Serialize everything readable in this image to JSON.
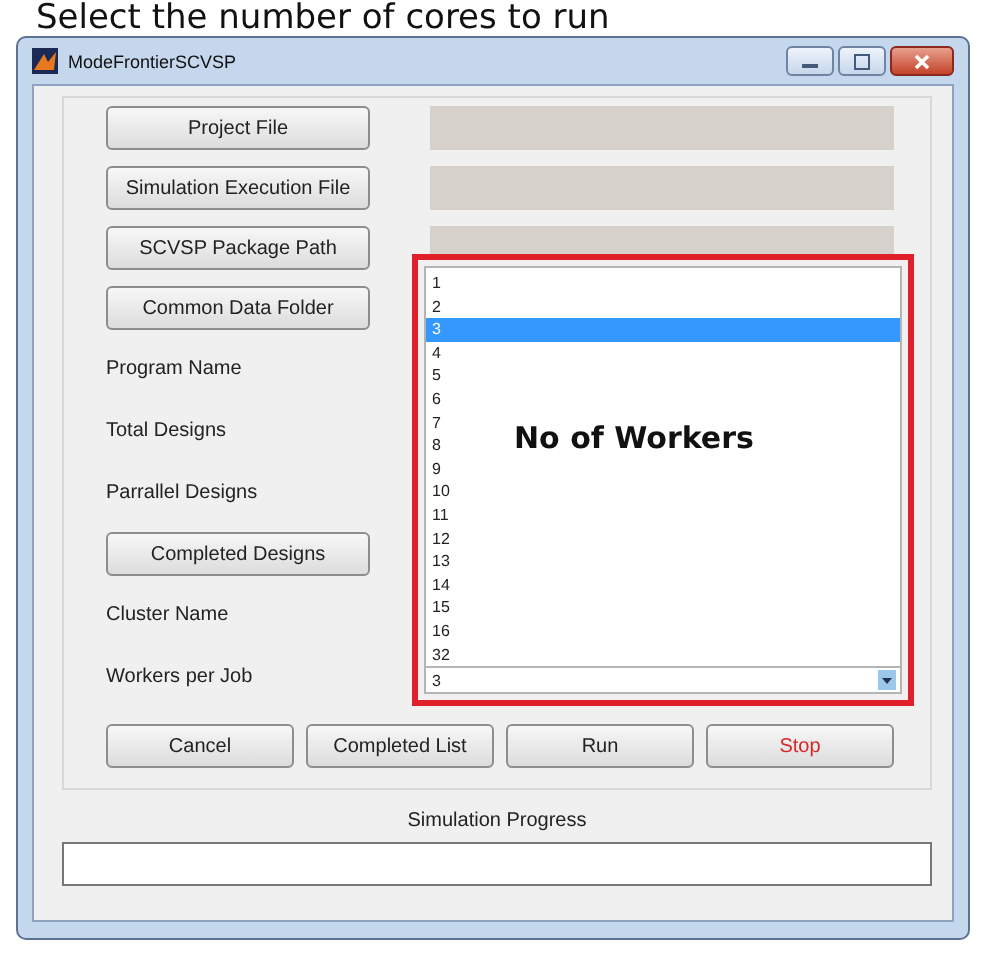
{
  "caption": "Select the number of cores to run",
  "window": {
    "title": "ModeFrontierSCVSP"
  },
  "rows": [
    {
      "kind": "button",
      "label": "Project File",
      "field": true
    },
    {
      "kind": "button",
      "label": "Simulation Execution File",
      "field": true
    },
    {
      "kind": "button",
      "label": "SCVSP Package Path",
      "field": true
    },
    {
      "kind": "button",
      "label": "Common Data Folder"
    },
    {
      "kind": "label",
      "label": "Program Name"
    },
    {
      "kind": "label",
      "label": "Total Designs"
    },
    {
      "kind": "label",
      "label": "Parrallel Designs"
    },
    {
      "kind": "button",
      "label": "Completed Designs"
    },
    {
      "kind": "label",
      "label": "Cluster Name"
    },
    {
      "kind": "label",
      "label": "Workers per Job"
    }
  ],
  "dropdown": {
    "value": "3",
    "options": [
      {
        "label": "1",
        "selected": false
      },
      {
        "label": "2",
        "selected": false
      },
      {
        "label": "3",
        "selected": true
      },
      {
        "label": "4",
        "selected": false
      },
      {
        "label": "5",
        "selected": false
      },
      {
        "label": "6",
        "selected": false
      },
      {
        "label": "7",
        "selected": false
      },
      {
        "label": "8",
        "selected": false
      },
      {
        "label": "9",
        "selected": false
      },
      {
        "label": "10",
        "selected": false
      },
      {
        "label": "11",
        "selected": false
      },
      {
        "label": "12",
        "selected": false
      },
      {
        "label": "13",
        "selected": false
      },
      {
        "label": "14",
        "selected": false
      },
      {
        "label": "15",
        "selected": false
      },
      {
        "label": "16",
        "selected": false
      },
      {
        "label": "32",
        "selected": false
      }
    ]
  },
  "annotation": {
    "text": "No of Workers"
  },
  "buttons": [
    {
      "label": "Cancel",
      "kind": "normal"
    },
    {
      "label": "Completed List",
      "kind": "normal"
    },
    {
      "label": "Run",
      "kind": "normal"
    },
    {
      "label": "Stop",
      "kind": "danger"
    }
  ],
  "progress": {
    "label": "Simulation Progress"
  }
}
